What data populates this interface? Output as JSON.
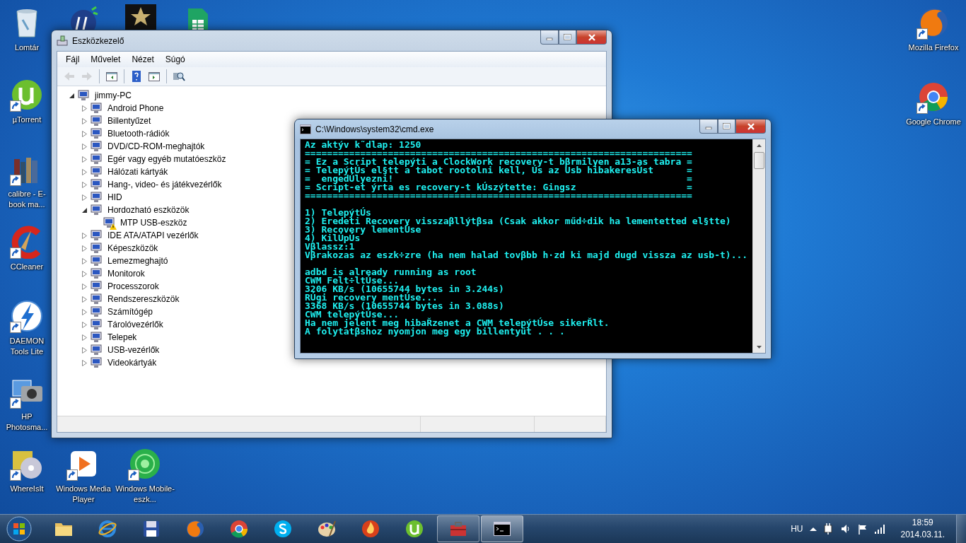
{
  "desktop_icons": [
    {
      "kind": "recycle-bin",
      "label": "Lomtár",
      "shortcut": false
    },
    {
      "kind": "utorrent",
      "label": "µTorrent",
      "shortcut": true
    },
    {
      "kind": "books",
      "label": "calibre - E-book ma...",
      "shortcut": true
    },
    {
      "kind": "ccleaner",
      "label": "CCleaner",
      "shortcut": true
    },
    {
      "kind": "daemon",
      "label": "DAEMON Tools Lite",
      "shortcut": true
    },
    {
      "kind": "camera",
      "label": "HP Photosma...",
      "shortcut": true
    },
    {
      "kind": "disc",
      "label": "WhereIsIt",
      "shortcut": true
    },
    {
      "kind": "media-player",
      "label": "Windows Media Player",
      "shortcut": true
    },
    {
      "kind": "sphere",
      "label": "Windows Mobile-eszk...",
      "shortcut": true
    },
    {
      "kind": "hp",
      "shortcut": false
    },
    {
      "kind": "star",
      "shortcut": false
    },
    {
      "kind": "sheets",
      "shortcut": false
    },
    {
      "kind": "firefox",
      "label": "Mozilla Firefox",
      "shortcut": true
    },
    {
      "kind": "chrome",
      "label": "Google Chrome",
      "shortcut": true
    }
  ],
  "device_manager": {
    "title": "Eszközkezelő",
    "menu": [
      "Fájl",
      "Művelet",
      "Nézet",
      "Súgó"
    ],
    "toolbar": [
      {
        "kind": "back",
        "disabled": true
      },
      {
        "kind": "forward",
        "disabled": true
      },
      {
        "kind": "separator"
      },
      {
        "kind": "console-tree",
        "disabled": false
      },
      {
        "kind": "separator"
      },
      {
        "kind": "help",
        "disabled": false
      },
      {
        "kind": "action-pane",
        "disabled": false
      },
      {
        "kind": "separator"
      },
      {
        "kind": "scan",
        "disabled": false
      }
    ],
    "tree": {
      "label": "jimmy-PC",
      "expanded": true,
      "warning": false,
      "children": [
        {
          "label": "Android Phone",
          "expanded": false,
          "warning": false
        },
        {
          "label": "Billentyűzet",
          "expanded": false,
          "warning": false
        },
        {
          "label": "Bluetooth-rádiók",
          "expanded": false,
          "warning": false
        },
        {
          "label": "DVD/CD-ROM-meghajtók",
          "expanded": false,
          "warning": false
        },
        {
          "label": "Egér vagy egyéb mutatóeszköz",
          "expanded": false,
          "warning": false
        },
        {
          "label": "Hálózati kártyák",
          "expanded": false,
          "warning": false
        },
        {
          "label": "Hang-, video- és játékvezérlők",
          "expanded": false,
          "warning": false
        },
        {
          "label": "HID",
          "expanded": false,
          "warning": false
        },
        {
          "label": "Hordozható eszközök",
          "expanded": true,
          "warning": false,
          "children": [
            {
              "label": "MTP USB-eszköz",
              "warning": true
            }
          ]
        },
        {
          "label": "IDE ATA/ATAPI vezérlők",
          "expanded": false,
          "warning": false
        },
        {
          "label": "Képeszközök",
          "expanded": false,
          "warning": false
        },
        {
          "label": "Lemezmeghajtó",
          "expanded": false,
          "warning": false
        },
        {
          "label": "Monitorok",
          "expanded": false,
          "warning": false
        },
        {
          "label": "Processzorok",
          "expanded": false,
          "warning": false
        },
        {
          "label": "Rendszereszközök",
          "expanded": false,
          "warning": false
        },
        {
          "label": "Számítógép",
          "expanded": false,
          "warning": false
        },
        {
          "label": "Tárolóvezérlők",
          "expanded": false,
          "warning": false
        },
        {
          "label": "Telepek",
          "expanded": false,
          "warning": false
        },
        {
          "label": "USB-vezérlők",
          "expanded": false,
          "warning": false
        },
        {
          "label": "Videokártyák",
          "expanded": false,
          "warning": false
        }
      ]
    }
  },
  "cmd": {
    "title": "C:\\Windows\\system32\\cmd.exe",
    "blocks": [
      [
        "Az aktýv k˜dlap: 1250",
        "======================================================================",
        "= Ez a Script telepýti a ClockWork recovery-t bβrmilyen a13-as tabra =",
        "= TelepýtÚs el§tt a tabot rootolni kell, Ús az Usb hibakeresÚst      =",
        "=  engedÚlyezni!                                                     =",
        "= Script-et ýrta es recovery-t kÚszýtette: Gingsz                    =",
        "======================================================================"
      ],
      [
        "1) TelepýtÚs",
        "2) Eredeti Recovery visszaβllýtβsa (Csak akkor műd÷dik ha lementetted el§tte)",
        "3) Recovery lementÚse",
        "4) KilÚpÚs",
        "Vβlassz:1",
        "Vβrakozas az eszk÷zre (ha nem halad tovβbb h·zd ki majd dugd vissza az usb-t)..."
      ],
      [
        "adbd is already running as root",
        "CWM Felt÷ltÚse...",
        "3206 KB/s (10655744 bytes in 3.244s)",
        "RÚgi recovery mentÚse...",
        "3368 KB/s (10655744 bytes in 3.088s)",
        "CWM telepýtÚse...",
        "Ha nem jelent meg hibaŘzenet a CWM telepýtÚse sikerŘlt.",
        "A folytatβshoz nyomjon meg egy billentyűt . . ."
      ]
    ]
  },
  "taskbar": {
    "pinned": [
      {
        "kind": "explorer",
        "running": false,
        "selected": false
      },
      {
        "kind": "ie",
        "running": false,
        "selected": false
      },
      {
        "kind": "floppy",
        "running": false,
        "selected": false
      },
      {
        "kind": "firefox",
        "running": false,
        "selected": false
      },
      {
        "kind": "chrome",
        "running": false,
        "selected": false
      },
      {
        "kind": "skype",
        "running": false,
        "selected": false
      },
      {
        "kind": "paint",
        "running": false,
        "selected": false
      },
      {
        "kind": "flame",
        "running": false,
        "selected": false
      },
      {
        "kind": "utorrent",
        "running": false,
        "selected": false
      },
      {
        "kind": "toolbox",
        "running": true,
        "selected": false
      },
      {
        "kind": "cmd",
        "running": true,
        "selected": true
      }
    ],
    "language": "HU",
    "time": "18:59",
    "date": "2014.03.11."
  }
}
